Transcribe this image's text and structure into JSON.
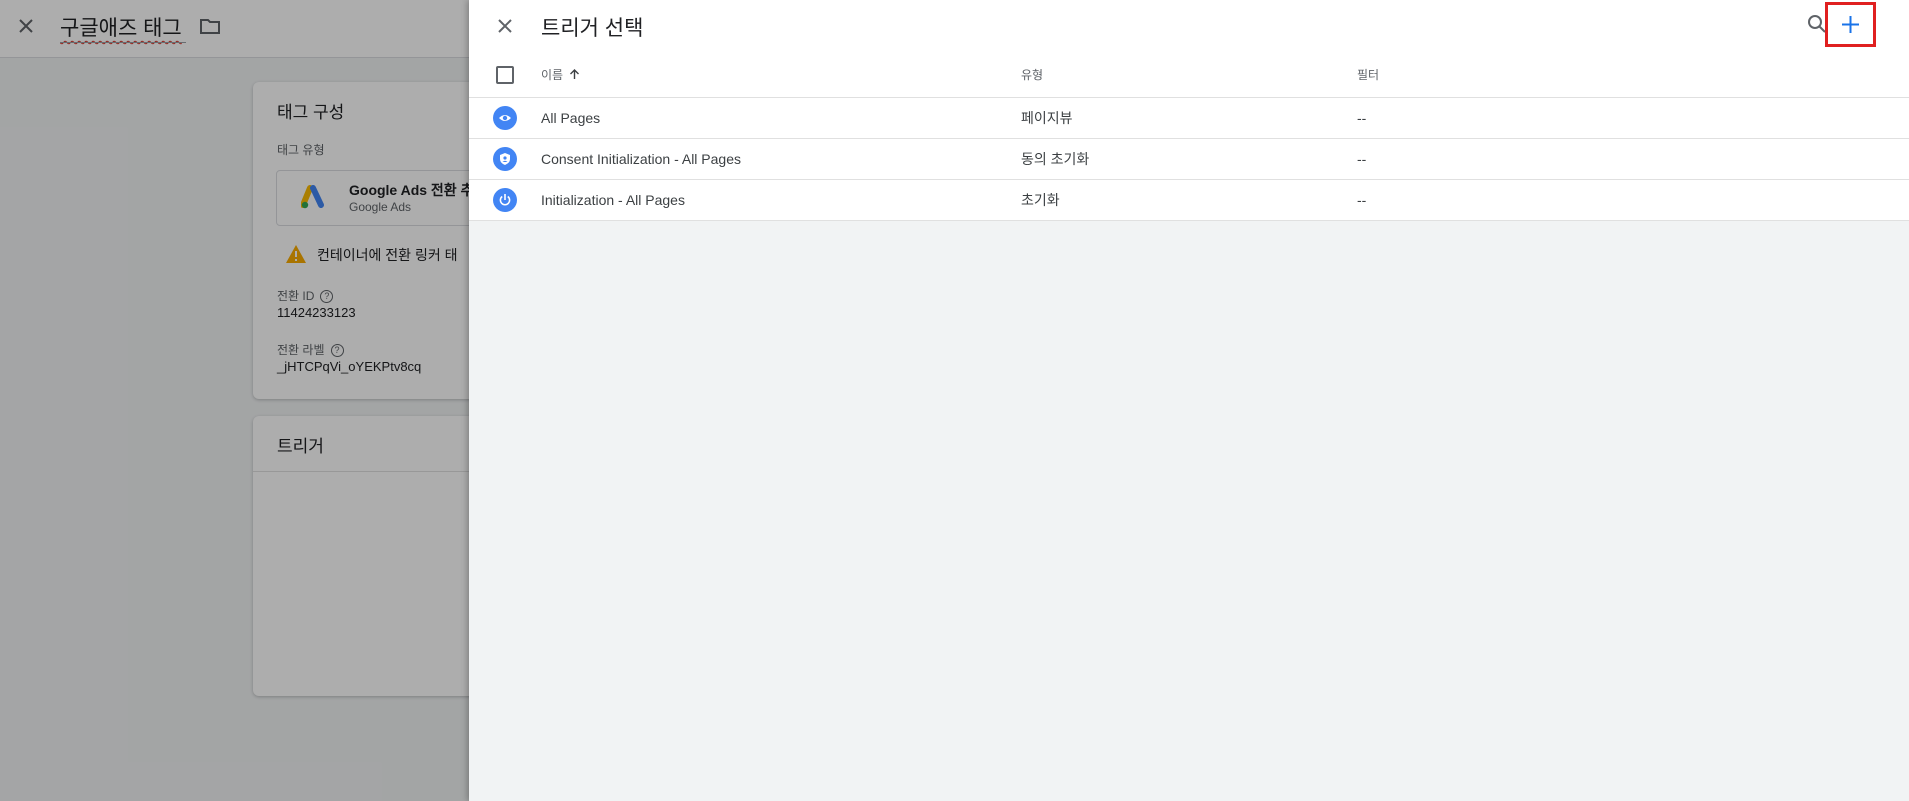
{
  "background": {
    "tag_name": "구글애즈 태그",
    "config_card": {
      "title": "태그 구성",
      "tag_type_label": "태그 유형",
      "tag_type_title": "Google Ads 전환 추",
      "tag_type_subtitle": "Google Ads",
      "warning_text": "컨테이너에 전환 링커 태",
      "conversion_id_label": "전환 ID",
      "conversion_id_value": "11424233123",
      "conversion_label_label": "전환 라벨",
      "conversion_label_value": "_jHTCPqVi_oYEKPtv8cq"
    },
    "trigger_card": {
      "title": "트리거"
    }
  },
  "panel": {
    "title": "트리거 선택",
    "columns": {
      "name": "이름",
      "type": "유형",
      "filter": "필터"
    },
    "rows": [
      {
        "icon": "eye-icon",
        "name": "All Pages",
        "type": "페이지뷰",
        "filter": "--"
      },
      {
        "icon": "shield-icon",
        "name": "Consent Initialization - All Pages",
        "type": "동의 초기화",
        "filter": "--"
      },
      {
        "icon": "power-icon",
        "name": "Initialization - All Pages",
        "type": "초기화",
        "filter": "--"
      }
    ]
  },
  "colors": {
    "accent": "#1a73e8",
    "trigger_icon": "#4285f4",
    "highlight_box": "#e02020",
    "warning": "#f9ab00"
  }
}
